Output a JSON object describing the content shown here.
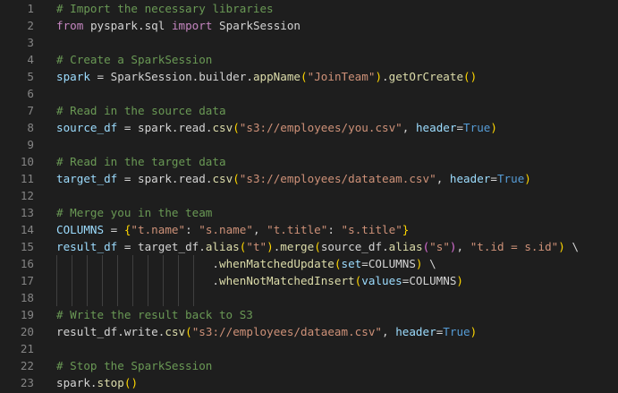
{
  "editor": {
    "language": "python",
    "theme_colors": {
      "background": "#1e1e1e",
      "line_number": "#858585",
      "comment": "#6a9955",
      "keyword": "#c586c0",
      "variable": "#9cdcfe",
      "function": "#dcdcaa",
      "string": "#ce9178",
      "constant": "#569cd6",
      "bracket_1": "#ffd700",
      "bracket_2": "#da70d6"
    },
    "lines": [
      {
        "n": "1",
        "tokens": [
          [
            "cm",
            "# Import the necessary libraries"
          ]
        ]
      },
      {
        "n": "2",
        "tokens": [
          [
            "kw",
            "from"
          ],
          [
            "pn",
            " "
          ],
          [
            "id",
            "pyspark.sql"
          ],
          [
            "pn",
            " "
          ],
          [
            "kw",
            "import"
          ],
          [
            "pn",
            " "
          ],
          [
            "id",
            "SparkSession"
          ]
        ]
      },
      {
        "n": "3",
        "tokens": []
      },
      {
        "n": "4",
        "tokens": [
          [
            "cm",
            "# Create a SparkSession"
          ]
        ]
      },
      {
        "n": "5",
        "tokens": [
          [
            "vr",
            "spark"
          ],
          [
            "op",
            " = "
          ],
          [
            "id",
            "SparkSession"
          ],
          [
            "pn",
            "."
          ],
          [
            "id",
            "builder"
          ],
          [
            "pn",
            "."
          ],
          [
            "fn",
            "appName"
          ],
          [
            "b1",
            "("
          ],
          [
            "st",
            "\"JoinTeam\""
          ],
          [
            "b1",
            ")"
          ],
          [
            "pn",
            "."
          ],
          [
            "fn",
            "getOrCreate"
          ],
          [
            "b1",
            "()"
          ]
        ]
      },
      {
        "n": "6",
        "tokens": []
      },
      {
        "n": "7",
        "tokens": [
          [
            "cm",
            "# Read in the source data"
          ]
        ]
      },
      {
        "n": "8",
        "tokens": [
          [
            "vr",
            "source_df"
          ],
          [
            "op",
            " = "
          ],
          [
            "id",
            "spark"
          ],
          [
            "pn",
            "."
          ],
          [
            "id",
            "read"
          ],
          [
            "pn",
            "."
          ],
          [
            "fn",
            "csv"
          ],
          [
            "b1",
            "("
          ],
          [
            "st",
            "\"s3://employees/you.csv\""
          ],
          [
            "pn",
            ", "
          ],
          [
            "vr",
            "header"
          ],
          [
            "op",
            "="
          ],
          [
            "k",
            "True"
          ],
          [
            "b1",
            ")"
          ]
        ]
      },
      {
        "n": "9",
        "tokens": []
      },
      {
        "n": "10",
        "tokens": [
          [
            "cm",
            "# Read in the target data"
          ]
        ]
      },
      {
        "n": "11",
        "tokens": [
          [
            "vr",
            "target_df"
          ],
          [
            "op",
            " = "
          ],
          [
            "id",
            "spark"
          ],
          [
            "pn",
            "."
          ],
          [
            "id",
            "read"
          ],
          [
            "pn",
            "."
          ],
          [
            "fn",
            "csv"
          ],
          [
            "b1",
            "("
          ],
          [
            "st",
            "\"s3://employees/datateam.csv\""
          ],
          [
            "pn",
            ", "
          ],
          [
            "vr",
            "header"
          ],
          [
            "op",
            "="
          ],
          [
            "k",
            "True"
          ],
          [
            "b1",
            ")"
          ]
        ]
      },
      {
        "n": "12",
        "tokens": []
      },
      {
        "n": "13",
        "tokens": [
          [
            "cm",
            "# Merge you in the team"
          ]
        ]
      },
      {
        "n": "14",
        "tokens": [
          [
            "vr",
            "COLUMNS"
          ],
          [
            "op",
            " = "
          ],
          [
            "b1",
            "{"
          ],
          [
            "st",
            "\"t.name\""
          ],
          [
            "pn",
            ": "
          ],
          [
            "st",
            "\"s.name\""
          ],
          [
            "pn",
            ", "
          ],
          [
            "st",
            "\"t.title\""
          ],
          [
            "pn",
            ": "
          ],
          [
            "st",
            "\"s.title\""
          ],
          [
            "b1",
            "}"
          ]
        ]
      },
      {
        "n": "15",
        "tokens": [
          [
            "vr",
            "result_df"
          ],
          [
            "op",
            " = "
          ],
          [
            "id",
            "target_df"
          ],
          [
            "pn",
            "."
          ],
          [
            "fn",
            "alias"
          ],
          [
            "b1",
            "("
          ],
          [
            "st",
            "\"t\""
          ],
          [
            "b1",
            ")"
          ],
          [
            "pn",
            "."
          ],
          [
            "fn",
            "merge"
          ],
          [
            "b1",
            "("
          ],
          [
            "id",
            "source_df"
          ],
          [
            "pn",
            "."
          ],
          [
            "fn",
            "alias"
          ],
          [
            "b2",
            "("
          ],
          [
            "st",
            "\"s\""
          ],
          [
            "b2",
            ")"
          ],
          [
            "pn",
            ", "
          ],
          [
            "st",
            "\"t.id = s.id\""
          ],
          [
            "b1",
            ")"
          ],
          [
            "pn",
            " \\"
          ]
        ]
      },
      {
        "n": "16",
        "tokens": [
          [
            "pn",
            "                       ."
          ],
          [
            "fn",
            "whenMatchedUpdate"
          ],
          [
            "b1",
            "("
          ],
          [
            "vr",
            "set"
          ],
          [
            "op",
            "="
          ],
          [
            "id",
            "COLUMNS"
          ],
          [
            "b1",
            ")"
          ],
          [
            "pn",
            " \\"
          ]
        ]
      },
      {
        "n": "17",
        "tokens": [
          [
            "pn",
            "                       ."
          ],
          [
            "fn",
            "whenNotMatchedInsert"
          ],
          [
            "b1",
            "("
          ],
          [
            "vr",
            "values"
          ],
          [
            "op",
            "="
          ],
          [
            "id",
            "COLUMNS"
          ],
          [
            "b1",
            ")"
          ]
        ]
      },
      {
        "n": "18",
        "tokens": []
      },
      {
        "n": "19",
        "tokens": [
          [
            "cm",
            "# Write the result back to S3"
          ]
        ]
      },
      {
        "n": "20",
        "tokens": [
          [
            "id",
            "result_df"
          ],
          [
            "pn",
            "."
          ],
          [
            "id",
            "write"
          ],
          [
            "pn",
            "."
          ],
          [
            "fn",
            "csv"
          ],
          [
            "b1",
            "("
          ],
          [
            "st",
            "\"s3://employees/dataeam.csv\""
          ],
          [
            "pn",
            ", "
          ],
          [
            "vr",
            "header"
          ],
          [
            "op",
            "="
          ],
          [
            "k",
            "True"
          ],
          [
            "b1",
            ")"
          ]
        ]
      },
      {
        "n": "21",
        "tokens": []
      },
      {
        "n": "22",
        "tokens": [
          [
            "cm",
            "# Stop the SparkSession"
          ]
        ]
      },
      {
        "n": "23",
        "tokens": [
          [
            "id",
            "spark"
          ],
          [
            "pn",
            "."
          ],
          [
            "fn",
            "stop"
          ],
          [
            "b1",
            "()"
          ]
        ]
      }
    ]
  }
}
